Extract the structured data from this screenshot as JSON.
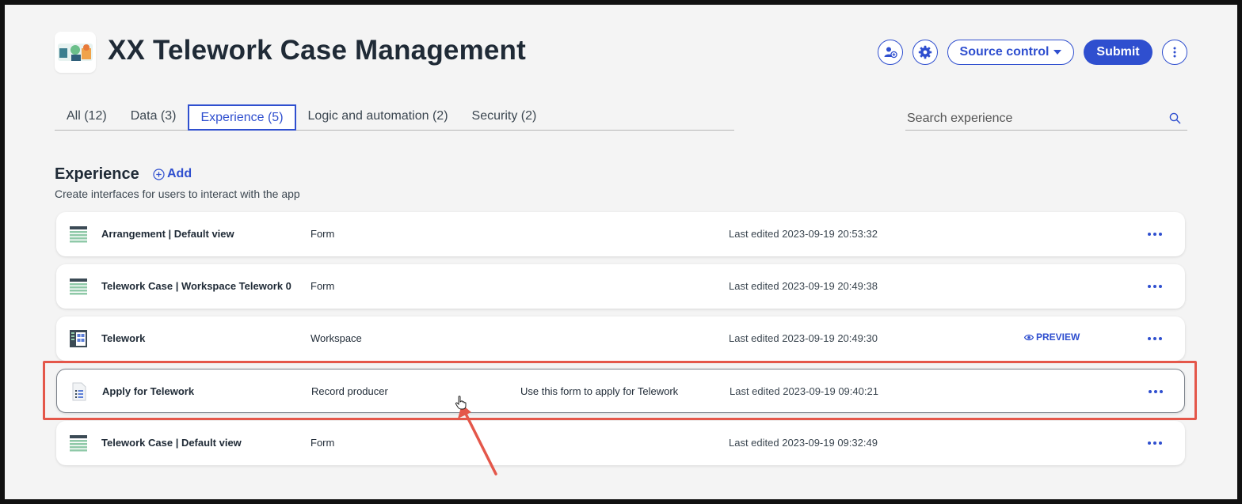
{
  "app": {
    "title": "XX Telework Case Management"
  },
  "header": {
    "source_control_label": "Source control",
    "submit_label": "Submit"
  },
  "tabs": [
    {
      "label": "All (12)",
      "active": false
    },
    {
      "label": "Data (3)",
      "active": false
    },
    {
      "label": "Experience (5)",
      "active": true
    },
    {
      "label": "Logic and automation (2)",
      "active": false
    },
    {
      "label": "Security (2)",
      "active": false
    }
  ],
  "search": {
    "placeholder": "Search experience"
  },
  "section": {
    "title": "Experience",
    "add_label": "Add",
    "description": "Create interfaces for users to interact with the app"
  },
  "rows": [
    {
      "icon": "form-icon",
      "name": "Arrangement | Default view",
      "type": "Form",
      "description": "",
      "edited": "Last edited 2023-09-19 20:53:32",
      "preview": ""
    },
    {
      "icon": "form-icon",
      "name": "Telework Case | Workspace Telework 0",
      "type": "Form",
      "description": "",
      "edited": "Last edited 2023-09-19 20:49:38",
      "preview": ""
    },
    {
      "icon": "workspace-icon",
      "name": "Telework",
      "type": "Workspace",
      "description": "",
      "edited": "Last edited 2023-09-19 20:49:30",
      "preview": "PREVIEW"
    },
    {
      "icon": "record-producer-icon",
      "name": "Apply for Telework",
      "type": "Record producer",
      "description": "Use this form to apply for Telework",
      "edited": "Last edited 2023-09-19 09:40:21",
      "preview": ""
    },
    {
      "icon": "form-icon",
      "name": "Telework Case | Default view",
      "type": "Form",
      "description": "",
      "edited": "Last edited 2023-09-19 09:32:49",
      "preview": ""
    }
  ],
  "colors": {
    "accent": "#2f4fcf",
    "annotation": "#e4574a",
    "background": "#f4f4f4"
  }
}
